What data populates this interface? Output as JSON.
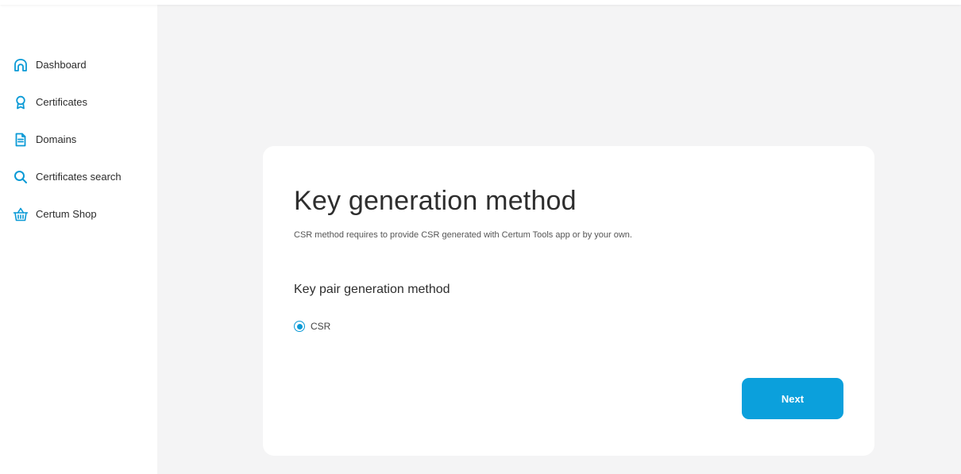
{
  "colors": {
    "accent": "#0ba0dc",
    "page_background": "#f4f4f5",
    "card_background": "#ffffff",
    "text_primary": "#2e2e2e"
  },
  "sidebar": {
    "items": [
      {
        "label": "Dashboard",
        "icon": "home-icon"
      },
      {
        "label": "Certificates",
        "icon": "award-icon"
      },
      {
        "label": "Domains",
        "icon": "document-icon"
      },
      {
        "label": "Certificates search",
        "icon": "search-icon"
      },
      {
        "label": "Certum Shop",
        "icon": "basket-icon"
      }
    ]
  },
  "card": {
    "title": "Key generation method",
    "subtitle": "CSR method requires to provide CSR generated with Certum Tools app or by your own.",
    "section_title": "Key pair generation method",
    "options": [
      {
        "label": "CSR",
        "selected": true
      }
    ],
    "next_label": "Next"
  }
}
